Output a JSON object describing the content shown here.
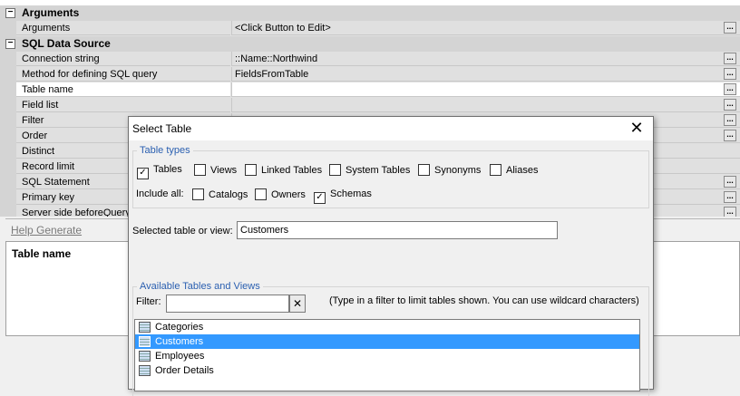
{
  "property_grid": {
    "categories": [
      {
        "label": "Arguments",
        "toggle": "−"
      },
      {
        "label": "SQL Data Source",
        "toggle": "−"
      }
    ],
    "properties": [
      {
        "name": "Arguments",
        "value": "<Click Button to Edit>"
      },
      {
        "name": "Connection string",
        "value": "::Name::Northwind"
      },
      {
        "name": "Method for defining SQL query",
        "value": "FieldsFromTable"
      },
      {
        "name": "Table name",
        "value": ""
      },
      {
        "name": "Field list",
        "value": ""
      },
      {
        "name": "Filter",
        "value": ""
      },
      {
        "name": "Order",
        "value": ""
      },
      {
        "name": "Distinct",
        "value": ""
      },
      {
        "name": "Record limit",
        "value": ""
      },
      {
        "name": "SQL Statement",
        "value": ""
      },
      {
        "name": "Primary key",
        "value": ""
      },
      {
        "name": "Server side beforeQuery",
        "value": ""
      }
    ],
    "ellipsis": "..."
  },
  "help": {
    "link": "Help Generate"
  },
  "description": {
    "title": "Table name"
  },
  "dialog": {
    "title": "Select Table",
    "close": "✕",
    "table_types": {
      "legend": "Table types",
      "options": [
        {
          "label": "Tables",
          "checked": true
        },
        {
          "label": "Views",
          "checked": false
        },
        {
          "label": "Linked Tables",
          "checked": false
        },
        {
          "label": "System Tables",
          "checked": false
        },
        {
          "label": "Synonyms",
          "checked": false
        },
        {
          "label": "Aliases",
          "checked": false
        }
      ],
      "include_all_label": "Include all:",
      "include_all": [
        {
          "label": "Catalogs",
          "checked": false
        },
        {
          "label": "Owners",
          "checked": false
        },
        {
          "label": "Schemas",
          "checked": true
        }
      ]
    },
    "selected": {
      "label": "Selected table or view:",
      "value": "Customers"
    },
    "available": {
      "legend": "Available Tables and Views",
      "filter_label": "Filter:",
      "filter_value": "",
      "filter_clear": "✕",
      "hint": "(Type in a filter to limit tables shown. You can use wildcard characters)",
      "items": [
        "Categories",
        "Customers",
        "Employees",
        "Order Details"
      ],
      "selected_index": 1
    }
  }
}
